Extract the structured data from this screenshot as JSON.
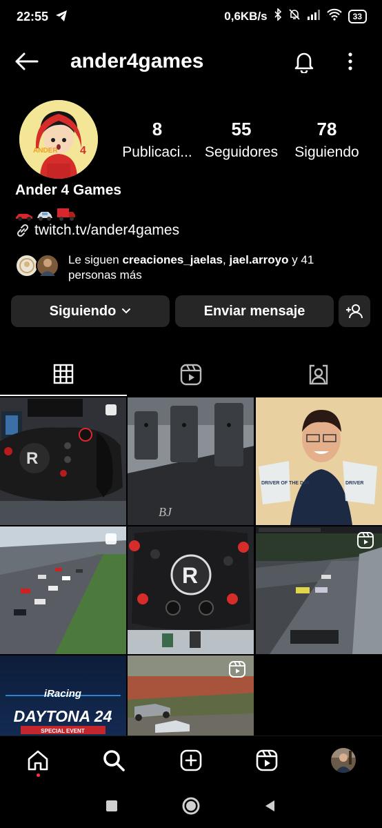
{
  "status_bar": {
    "time": "22:55",
    "network_speed": "0,6KB/s",
    "battery": "33"
  },
  "header": {
    "username": "ander4games"
  },
  "profile": {
    "avatar_text": "ANDER 4",
    "stats": [
      {
        "value": "8",
        "label": "Publicaci..."
      },
      {
        "value": "55",
        "label": "Seguidores"
      },
      {
        "value": "78",
        "label": "Siguiendo"
      }
    ],
    "display_name": "Ander 4 Games",
    "bio_emoji": [
      "race-car-icon",
      "car-icon",
      "truck-icon"
    ],
    "link": "twitch.tv/ander4games",
    "followed_by": {
      "prefix": "Le siguen ",
      "user1": "creaciones_jaelas",
      "separator": ", ",
      "user2": "jael.arroyo",
      "suffix": " y 41 personas más"
    }
  },
  "actions": {
    "following_label": "Siguiendo",
    "message_label": "Enviar mensaje"
  },
  "grid_posts": {
    "post7_brand": "iRacing",
    "post7_title": "DAYTONA 24",
    "post7_subtitle": "SPECIAL EVENT",
    "post2_text": "BJ",
    "post3_trophy": "DRIVER OF THE DAY"
  },
  "colors": {
    "background": "#000000",
    "button": "#262626",
    "notification_dot": "#ff3040"
  }
}
